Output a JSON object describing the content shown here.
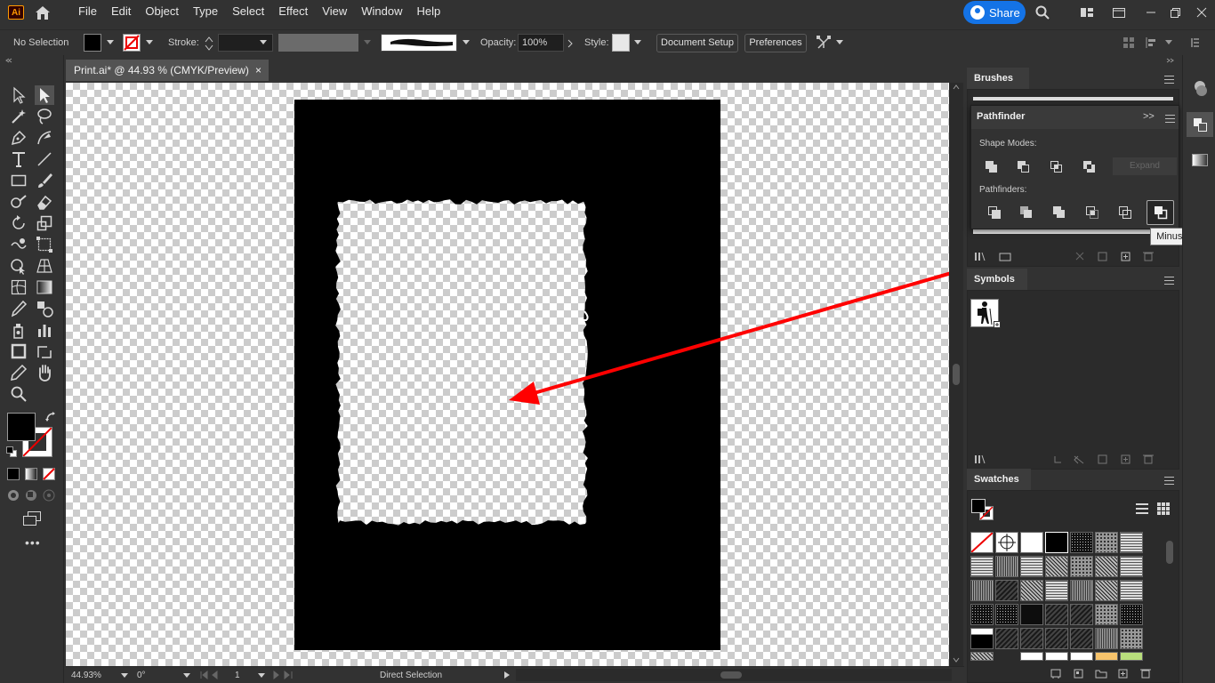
{
  "app": {
    "logo": "Ai",
    "menu": [
      "File",
      "Edit",
      "Object",
      "Type",
      "Select",
      "Effect",
      "View",
      "Window",
      "Help"
    ],
    "share_label": "Share"
  },
  "control_bar": {
    "selection": "No Selection",
    "stroke_label": "Stroke:",
    "opacity_label": "Opacity:",
    "opacity_value": "100%",
    "style_label": "Style:",
    "document_setup": "Document Setup",
    "preferences": "Preferences",
    "fill_color": "#000000"
  },
  "document": {
    "tab_title": "Print.ai* @ 44.93 % (CMYK/Preview)",
    "close": "×"
  },
  "status_bar": {
    "zoom": "44.93%",
    "rotation": "0°",
    "artboard": "1",
    "tool": "Direct Selection"
  },
  "panels": {
    "brushes": "Brushes",
    "pathfinder": "Pathfinder",
    "shape_modes": "Shape Modes:",
    "expand": "Expand",
    "pathfinders": "Pathfinders:",
    "tooltip": "Minus Back",
    "symbols": "Symbols",
    "swatches": "Swatches",
    "more": ">>"
  },
  "colors": {
    "accent": "#1473e6",
    "annotation_arrow": "#ff0000",
    "panel_bg": "#323232"
  }
}
